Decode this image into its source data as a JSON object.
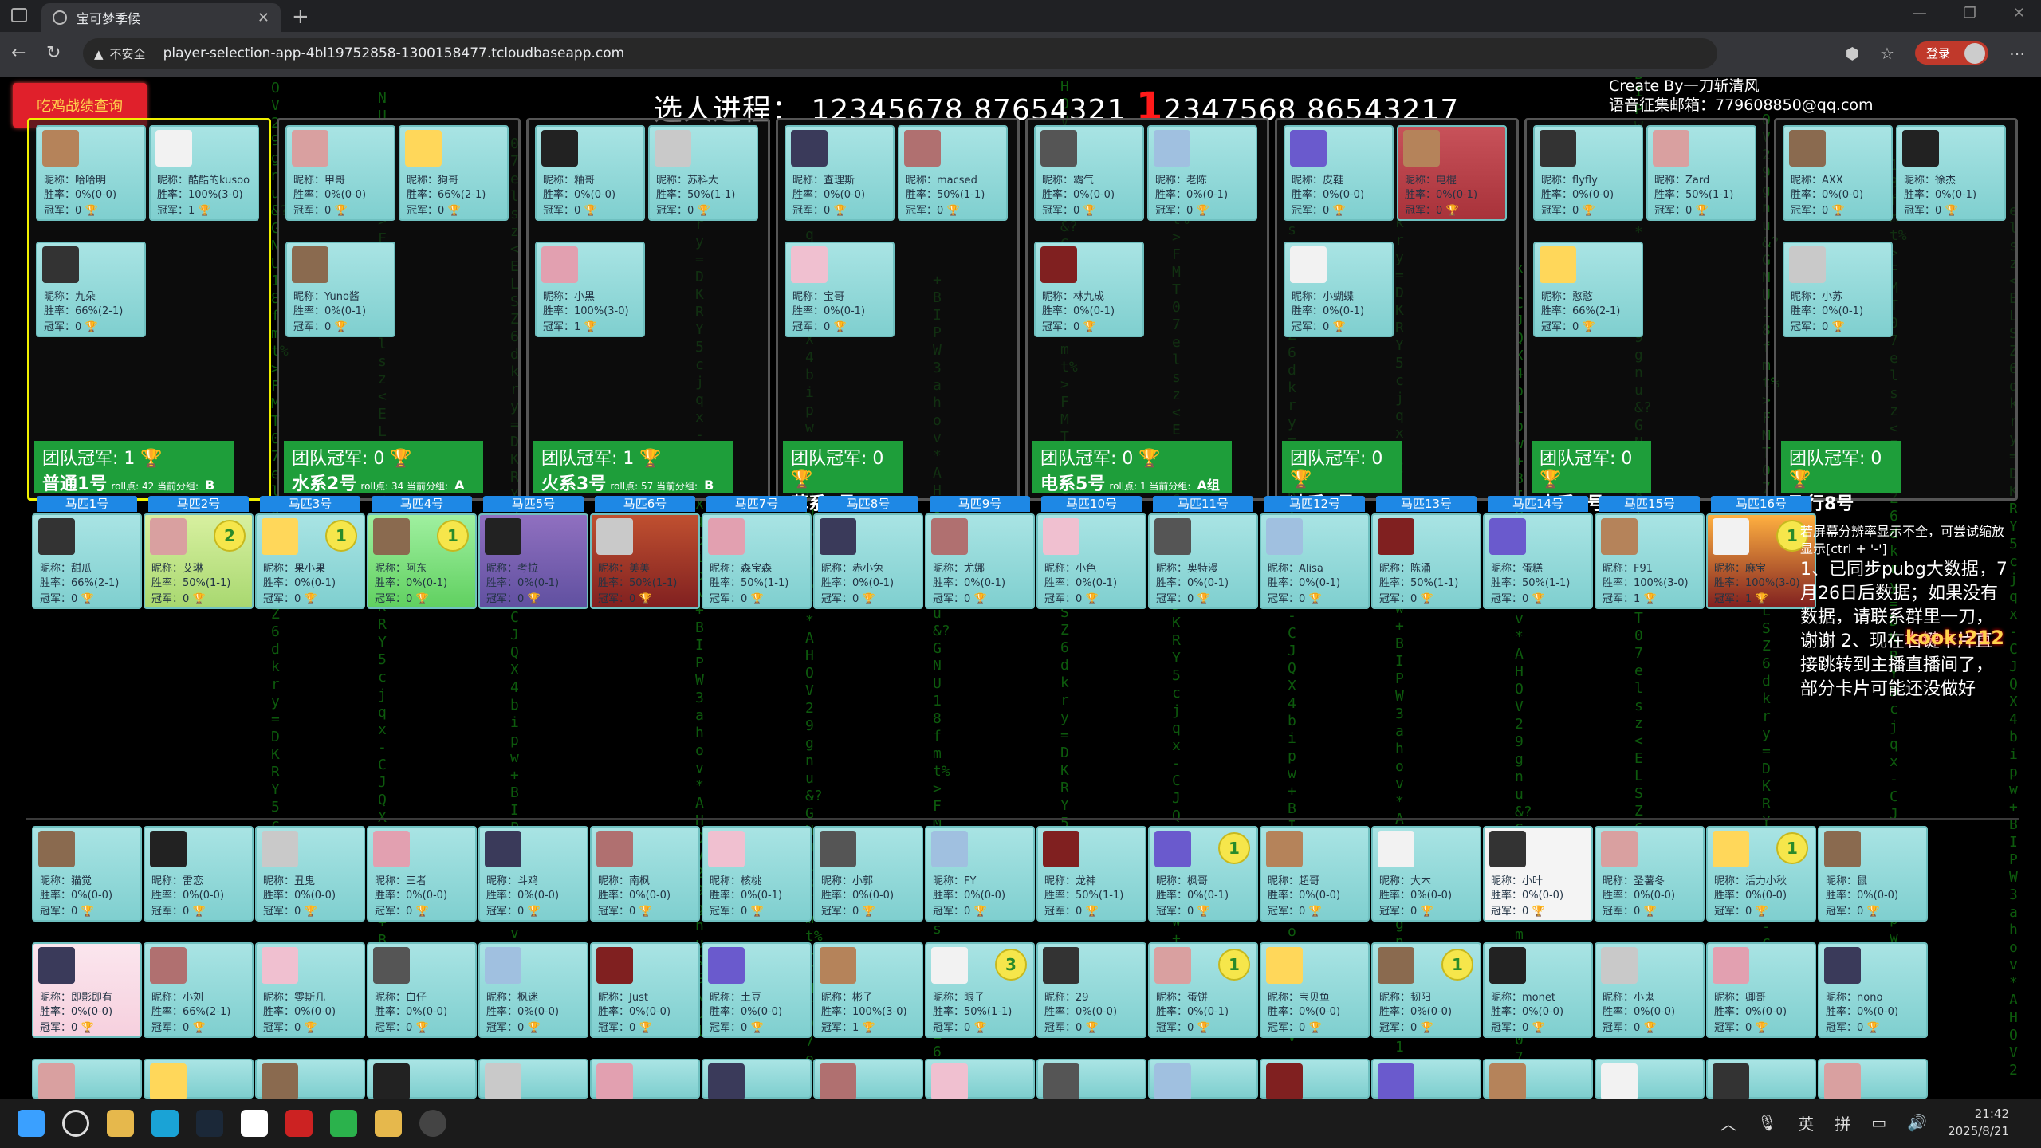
{
  "browser": {
    "tab_title": "宝可梦季候",
    "url_warning": "不安全",
    "url": "player-selection-app-4bl19752858-1300158477.tcloudbaseapp.com",
    "login_label": "登录"
  },
  "page": {
    "record_button": "吃鸡战绩查询",
    "progress_label": "选人进程：",
    "progress_part1": "12345678 87654321",
    "progress_highlight": "1",
    "progress_part2": "2347568 86543217",
    "credit_line1": "Create By一刀斩清风",
    "credit_line2": "语音征集邮箱：779608850@qq.com",
    "notice_small": "若屏幕分辨率显示不全，可尝试缩放显示[ctrl + '-']",
    "notice_main": "1、已同步pubg大数据，7月26日后数据；如果没有数据，请联系群里一刀，谢谢 2、现在右键卡片直接跳转到主播直播间了，部分卡片可能还没做好",
    "brand": "kook:212"
  },
  "labels": {
    "nick": "昵称：",
    "win": "胜率：",
    "champ": "冠军："
  },
  "teams": [
    {
      "name": "普通1号",
      "champ": "团队冠军: 1",
      "extra": "roll点: 42 当前分组:",
      "group": "B组",
      "members": [
        {
          "n": "哈哈明",
          "w": "0%(0-0)",
          "c": "0"
        },
        {
          "n": "酷酷的kusoo",
          "w": "100%(3-0)",
          "c": "1"
        },
        {
          "n": "九朵",
          "w": "66%(2-1)",
          "c": "0"
        }
      ]
    },
    {
      "name": "水系2号",
      "champ": "团队冠军: 0",
      "extra": "roll点: 34 当前分组:",
      "group": "A组",
      "members": [
        {
          "n": "甲哥",
          "w": "0%(0-0)",
          "c": "0"
        },
        {
          "n": "狗哥",
          "w": "66%(2-1)",
          "c": "0"
        },
        {
          "n": "Yuno酱",
          "w": "0%(0-1)",
          "c": "0"
        }
      ]
    },
    {
      "name": "火系3号",
      "champ": "团队冠军: 1",
      "extra": "roll点: 57 当前分组:",
      "group": "B组",
      "members": [
        {
          "n": "釉哥",
          "w": "0%(0-0)",
          "c": "0"
        },
        {
          "n": "苏科大",
          "w": "50%(1-1)",
          "c": "0"
        },
        {
          "n": "小黑",
          "w": "100%(3-0)",
          "c": "1"
        }
      ]
    },
    {
      "name": "草系4号",
      "champ": "团队冠军: 0",
      "extra": "",
      "group": "",
      "members": [
        {
          "n": "查理斯",
          "w": "0%(0-0)",
          "c": "0"
        },
        {
          "n": "macsed",
          "w": "50%(1-1)",
          "c": "0"
        },
        {
          "n": "宝哥",
          "w": "0%(0-1)",
          "c": "0"
        }
      ]
    },
    {
      "name": "电系5号",
      "champ": "团队冠军: 0",
      "extra": "roll点: 1 当前分组:",
      "group": "A组",
      "members": [
        {
          "n": "霸气",
          "w": "0%(0-0)",
          "c": "0"
        },
        {
          "n": "老陈",
          "w": "0%(0-1)",
          "c": "0"
        },
        {
          "n": "林九成",
          "w": "0%(0-1)",
          "c": "0"
        }
      ]
    },
    {
      "name": "冰系6号",
      "champ": "团队冠军: 0",
      "extra": "",
      "group": "",
      "members": [
        {
          "n": "皮鞋",
          "w": "0%(0-0)",
          "c": "0"
        },
        {
          "n": "电棍",
          "w": "0%(0-1)",
          "c": "0"
        },
        {
          "n": "小蝴蝶",
          "w": "0%(0-1)",
          "c": "0"
        }
      ]
    },
    {
      "name": "虫系7号",
      "champ": "团队冠军: 0",
      "extra": "",
      "group": "",
      "members": [
        {
          "n": "flyfly",
          "w": "0%(0-0)",
          "c": "0"
        },
        {
          "n": "Zard",
          "w": "50%(1-1)",
          "c": "0"
        },
        {
          "n": "憨憨",
          "w": "66%(2-1)",
          "c": "0"
        }
      ]
    },
    {
      "name": "飞行8号",
      "champ": "团队冠军: 0",
      "extra": "",
      "group": "",
      "members": [
        {
          "n": "AXX",
          "w": "0%(0-0)",
          "c": "0"
        },
        {
          "n": "徐杰",
          "w": "0%(0-1)",
          "c": "0"
        },
        {
          "n": "小苏",
          "w": "0%(0-1)",
          "c": "0"
        }
      ]
    }
  ],
  "horses": [
    {
      "label": "马匹1号",
      "n": "甜瓜",
      "w": "66%(2-1)",
      "c": "0"
    },
    {
      "label": "马匹2号",
      "n": "艾琳",
      "w": "50%(1-1)",
      "c": "0",
      "s": "2"
    },
    {
      "label": "马匹3号",
      "n": "果小果",
      "w": "0%(0-1)",
      "c": "0",
      "s": "1"
    },
    {
      "label": "马匹4号",
      "n": "阿东",
      "w": "0%(0-1)",
      "c": "0",
      "s": "1"
    },
    {
      "label": "马匹5号",
      "n": "考拉",
      "w": "0%(0-1)",
      "c": "0"
    },
    {
      "label": "马匹6号",
      "n": "美美",
      "w": "50%(1-1)",
      "c": "0"
    },
    {
      "label": "马匹7号",
      "n": "森宝森",
      "w": "50%(1-1)",
      "c": "0"
    },
    {
      "label": "马匹8号",
      "n": "赤小兔",
      "w": "0%(0-1)",
      "c": "0"
    },
    {
      "label": "马匹9号",
      "n": "尤娜",
      "w": "0%(0-1)",
      "c": "0"
    },
    {
      "label": "马匹10号",
      "n": "小色",
      "w": "0%(0-1)",
      "c": "0"
    },
    {
      "label": "马匹11号",
      "n": "奥特漫",
      "w": "0%(0-1)",
      "c": "0"
    },
    {
      "label": "马匹12号",
      "n": "Alisa",
      "w": "0%(0-1)",
      "c": "0"
    },
    {
      "label": "马匹13号",
      "n": "陈涌",
      "w": "50%(1-1)",
      "c": "0"
    },
    {
      "label": "马匹14号",
      "n": "蛋糕",
      "w": "50%(1-1)",
      "c": "0"
    },
    {
      "label": "马匹15号",
      "n": "F91",
      "w": "100%(3-0)",
      "c": "1"
    },
    {
      "label": "马匹16号",
      "n": "麻宝",
      "w": "100%(3-0)",
      "c": "1",
      "s": "1"
    }
  ],
  "pool_row1": [
    {
      "n": "猫觉",
      "w": "0%(0-0)",
      "c": "0"
    },
    {
      "n": "雷恋",
      "w": "0%(0-0)",
      "c": "0"
    },
    {
      "n": "丑鬼",
      "w": "0%(0-0)",
      "c": "0"
    },
    {
      "n": "三者",
      "w": "0%(0-0)",
      "c": "0"
    },
    {
      "n": "斗鸡",
      "w": "0%(0-0)",
      "c": "0"
    },
    {
      "n": "南枫",
      "w": "0%(0-0)",
      "c": "0"
    },
    {
      "n": "核桃",
      "w": "0%(0-1)",
      "c": "0"
    },
    {
      "n": "小郭",
      "w": "0%(0-0)",
      "c": "0"
    },
    {
      "n": "FY",
      "w": "0%(0-0)",
      "c": "0"
    },
    {
      "n": "龙神",
      "w": "50%(1-1)",
      "c": "0"
    },
    {
      "n": "枫哥",
      "w": "0%(0-1)",
      "c": "0",
      "s": "1"
    },
    {
      "n": "超哥",
      "w": "0%(0-0)",
      "c": "0"
    },
    {
      "n": "大木",
      "w": "0%(0-0)",
      "c": "0"
    },
    {
      "n": "小叶",
      "w": "0%(0-0)",
      "c": "0"
    },
    {
      "n": "圣薯冬",
      "w": "0%(0-0)",
      "c": "0"
    },
    {
      "n": "活力小秋",
      "w": "0%(0-0)",
      "c": "0",
      "s": "1"
    },
    {
      "n": "鼠",
      "w": "0%(0-0)",
      "c": "0"
    }
  ],
  "pool_row2": [
    {
      "n": "即影即有",
      "w": "0%(0-0)",
      "c": "0"
    },
    {
      "n": "小刘",
      "w": "66%(2-1)",
      "c": "0"
    },
    {
      "n": "零斯几",
      "w": "0%(0-0)",
      "c": "0"
    },
    {
      "n": "白仔",
      "w": "0%(0-0)",
      "c": "0"
    },
    {
      "n": "枫迷",
      "w": "0%(0-0)",
      "c": "0"
    },
    {
      "n": "Just",
      "w": "0%(0-0)",
      "c": "0"
    },
    {
      "n": "土豆",
      "w": "0%(0-0)",
      "c": "0"
    },
    {
      "n": "彬子",
      "w": "100%(3-0)",
      "c": "1"
    },
    {
      "n": "眼子",
      "w": "50%(1-1)",
      "c": "0",
      "s": "3"
    },
    {
      "n": "29",
      "w": "0%(0-0)",
      "c": "0"
    },
    {
      "n": "蛋饼",
      "w": "0%(0-1)",
      "c": "0",
      "s": "1"
    },
    {
      "n": "宝贝鱼",
      "w": "0%(0-0)",
      "c": "0"
    },
    {
      "n": "韧阳",
      "w": "0%(0-0)",
      "c": "0",
      "s": "1"
    },
    {
      "n": "monet",
      "w": "0%(0-0)",
      "c": "0"
    },
    {
      "n": "小鬼",
      "w": "0%(0-0)",
      "c": "0"
    },
    {
      "n": "卿哥",
      "w": "0%(0-0)",
      "c": "0"
    },
    {
      "n": "nono",
      "w": "0%(0-0)",
      "c": "0"
    }
  ],
  "taskbar": {
    "ime": "英",
    "ime2": "拼",
    "time": "21:42",
    "date": "2025/8/21"
  }
}
